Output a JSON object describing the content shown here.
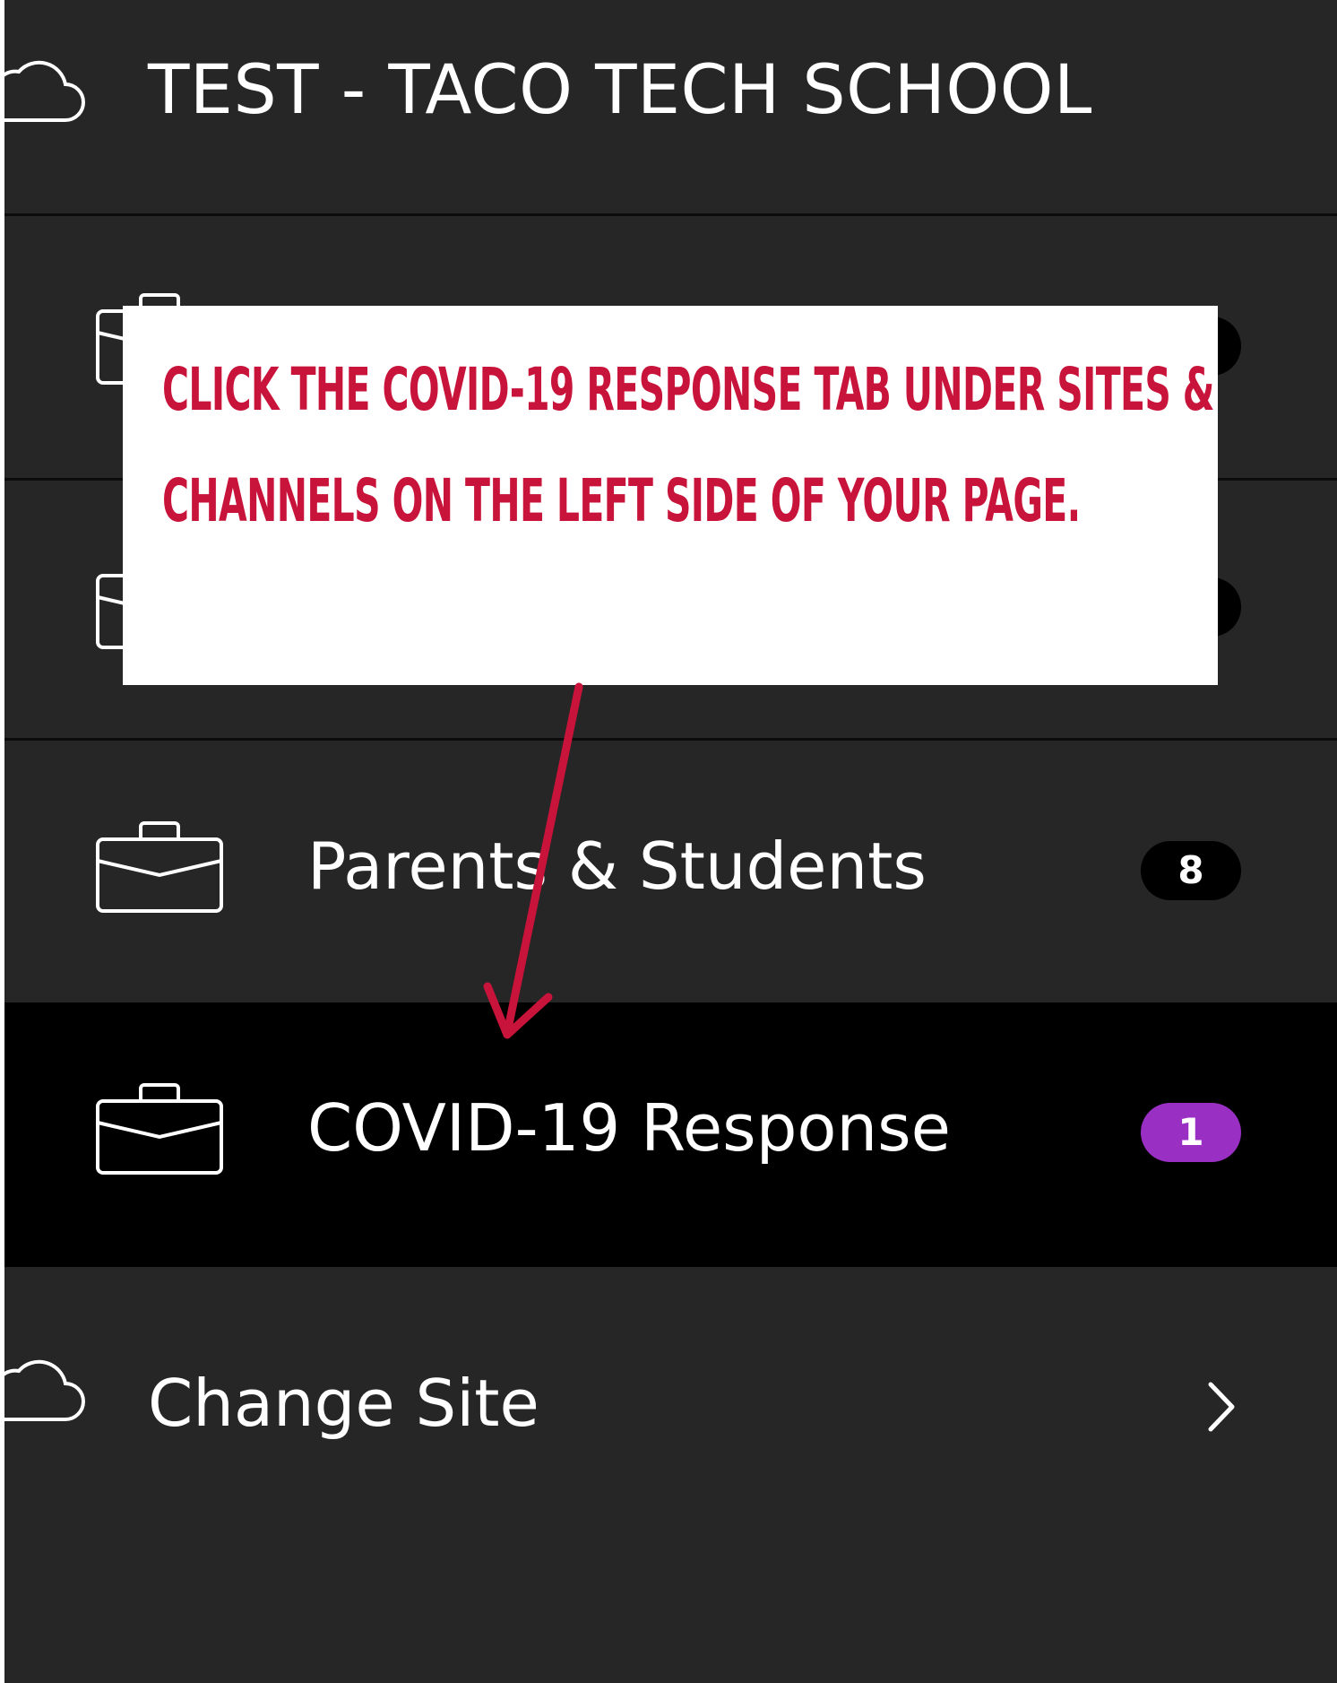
{
  "header": {
    "site_name": "TEST - TACO TECH SCHOOL",
    "icon": "cloud-icon"
  },
  "channels": [
    {
      "label": "",
      "badge": "",
      "icon": "briefcase-icon"
    },
    {
      "label": "",
      "badge": "",
      "icon": "briefcase-icon"
    },
    {
      "label": "Parents & Students",
      "badge": "8",
      "icon": "briefcase-icon"
    },
    {
      "label": "COVID-19 Response",
      "badge": "1",
      "icon": "briefcase-icon",
      "active": true
    }
  ],
  "change_site": {
    "label": "Change Site",
    "icon": "cloud-icon",
    "chevron": "chevron-right-icon"
  },
  "callout": {
    "text": "Click the COVID-19 Response tab under Sites & Channels on the left side of your page."
  },
  "colors": {
    "sidebar_bg": "#262626",
    "active_row_bg": "#000000",
    "badge_default": "#000000",
    "badge_active": "#9a2fc4",
    "callout_text": "#c8133a",
    "arrow": "#c8133a"
  }
}
